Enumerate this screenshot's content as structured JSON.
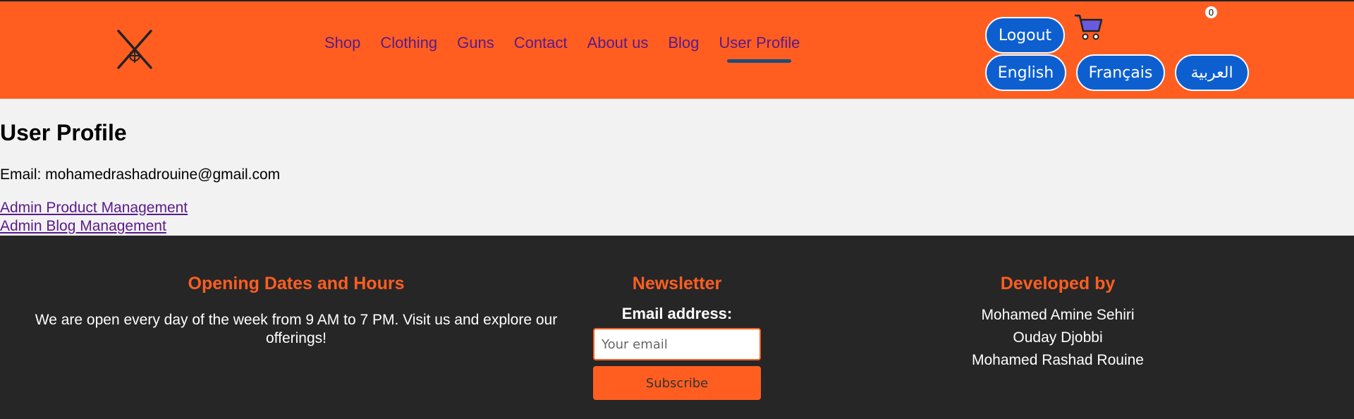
{
  "nav": {
    "items": [
      {
        "label": "Shop"
      },
      {
        "label": "Clothing"
      },
      {
        "label": "Guns"
      },
      {
        "label": "Contact"
      },
      {
        "label": "About us"
      },
      {
        "label": "Blog"
      },
      {
        "label": "User Profile",
        "active": true
      }
    ]
  },
  "header": {
    "logout_label": "Logout",
    "cart_count": "0",
    "languages": [
      "English",
      "Français",
      "العربية"
    ],
    "icons": {
      "logo": "crossed-rifles-logo",
      "cart": "shopping-cart-icon"
    },
    "colors": {
      "background": "#ff5e20",
      "pill": "#0d5fd0",
      "nav_link": "#5a1a8c"
    }
  },
  "main": {
    "title": "User Profile",
    "email_line": "Email: mohamedrashadrouine@gmail.com",
    "links": [
      "Admin Product Management",
      "Admin Blog Management"
    ]
  },
  "footer": {
    "hours": {
      "title": "Opening Dates and Hours",
      "text": "We are open every day of the week from 9 AM to 7 PM. Visit us and explore our offerings!"
    },
    "newsletter": {
      "title": "Newsletter",
      "label": "Email address:",
      "placeholder": "Your email",
      "button": "Subscribe"
    },
    "developers": {
      "title": "Developed by",
      "names": [
        "Mohamed Amine Sehiri",
        "Ouday Djobbi",
        "Mohamed Rashad Rouine"
      ]
    },
    "colors": {
      "background": "#262626",
      "accent": "#ff5e20"
    }
  }
}
